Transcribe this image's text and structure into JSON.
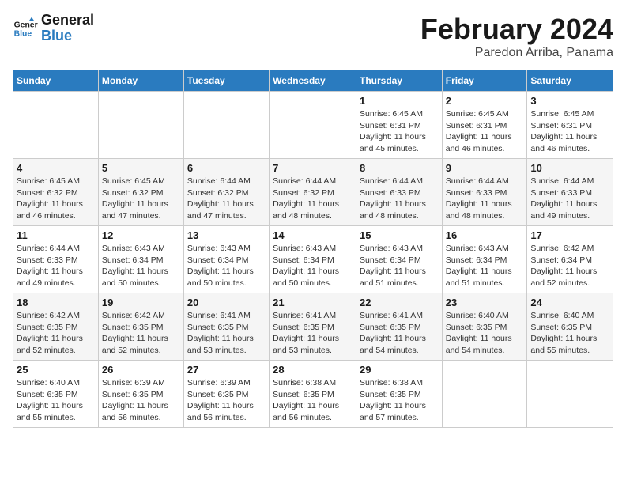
{
  "header": {
    "logo_general": "General",
    "logo_blue": "Blue",
    "title": "February 2024",
    "subtitle": "Paredon Arriba, Panama"
  },
  "calendar": {
    "days_of_week": [
      "Sunday",
      "Monday",
      "Tuesday",
      "Wednesday",
      "Thursday",
      "Friday",
      "Saturday"
    ],
    "weeks": [
      [
        {
          "day": "",
          "details": ""
        },
        {
          "day": "",
          "details": ""
        },
        {
          "day": "",
          "details": ""
        },
        {
          "day": "",
          "details": ""
        },
        {
          "day": "1",
          "details": "Sunrise: 6:45 AM\nSunset: 6:31 PM\nDaylight: 11 hours\nand 45 minutes."
        },
        {
          "day": "2",
          "details": "Sunrise: 6:45 AM\nSunset: 6:31 PM\nDaylight: 11 hours\nand 46 minutes."
        },
        {
          "day": "3",
          "details": "Sunrise: 6:45 AM\nSunset: 6:31 PM\nDaylight: 11 hours\nand 46 minutes."
        }
      ],
      [
        {
          "day": "4",
          "details": "Sunrise: 6:45 AM\nSunset: 6:32 PM\nDaylight: 11 hours\nand 46 minutes."
        },
        {
          "day": "5",
          "details": "Sunrise: 6:45 AM\nSunset: 6:32 PM\nDaylight: 11 hours\nand 47 minutes."
        },
        {
          "day": "6",
          "details": "Sunrise: 6:44 AM\nSunset: 6:32 PM\nDaylight: 11 hours\nand 47 minutes."
        },
        {
          "day": "7",
          "details": "Sunrise: 6:44 AM\nSunset: 6:32 PM\nDaylight: 11 hours\nand 48 minutes."
        },
        {
          "day": "8",
          "details": "Sunrise: 6:44 AM\nSunset: 6:33 PM\nDaylight: 11 hours\nand 48 minutes."
        },
        {
          "day": "9",
          "details": "Sunrise: 6:44 AM\nSunset: 6:33 PM\nDaylight: 11 hours\nand 48 minutes."
        },
        {
          "day": "10",
          "details": "Sunrise: 6:44 AM\nSunset: 6:33 PM\nDaylight: 11 hours\nand 49 minutes."
        }
      ],
      [
        {
          "day": "11",
          "details": "Sunrise: 6:44 AM\nSunset: 6:33 PM\nDaylight: 11 hours\nand 49 minutes."
        },
        {
          "day": "12",
          "details": "Sunrise: 6:43 AM\nSunset: 6:34 PM\nDaylight: 11 hours\nand 50 minutes."
        },
        {
          "day": "13",
          "details": "Sunrise: 6:43 AM\nSunset: 6:34 PM\nDaylight: 11 hours\nand 50 minutes."
        },
        {
          "day": "14",
          "details": "Sunrise: 6:43 AM\nSunset: 6:34 PM\nDaylight: 11 hours\nand 50 minutes."
        },
        {
          "day": "15",
          "details": "Sunrise: 6:43 AM\nSunset: 6:34 PM\nDaylight: 11 hours\nand 51 minutes."
        },
        {
          "day": "16",
          "details": "Sunrise: 6:43 AM\nSunset: 6:34 PM\nDaylight: 11 hours\nand 51 minutes."
        },
        {
          "day": "17",
          "details": "Sunrise: 6:42 AM\nSunset: 6:34 PM\nDaylight: 11 hours\nand 52 minutes."
        }
      ],
      [
        {
          "day": "18",
          "details": "Sunrise: 6:42 AM\nSunset: 6:35 PM\nDaylight: 11 hours\nand 52 minutes."
        },
        {
          "day": "19",
          "details": "Sunrise: 6:42 AM\nSunset: 6:35 PM\nDaylight: 11 hours\nand 52 minutes."
        },
        {
          "day": "20",
          "details": "Sunrise: 6:41 AM\nSunset: 6:35 PM\nDaylight: 11 hours\nand 53 minutes."
        },
        {
          "day": "21",
          "details": "Sunrise: 6:41 AM\nSunset: 6:35 PM\nDaylight: 11 hours\nand 53 minutes."
        },
        {
          "day": "22",
          "details": "Sunrise: 6:41 AM\nSunset: 6:35 PM\nDaylight: 11 hours\nand 54 minutes."
        },
        {
          "day": "23",
          "details": "Sunrise: 6:40 AM\nSunset: 6:35 PM\nDaylight: 11 hours\nand 54 minutes."
        },
        {
          "day": "24",
          "details": "Sunrise: 6:40 AM\nSunset: 6:35 PM\nDaylight: 11 hours\nand 55 minutes."
        }
      ],
      [
        {
          "day": "25",
          "details": "Sunrise: 6:40 AM\nSunset: 6:35 PM\nDaylight: 11 hours\nand 55 minutes."
        },
        {
          "day": "26",
          "details": "Sunrise: 6:39 AM\nSunset: 6:35 PM\nDaylight: 11 hours\nand 56 minutes."
        },
        {
          "day": "27",
          "details": "Sunrise: 6:39 AM\nSunset: 6:35 PM\nDaylight: 11 hours\nand 56 minutes."
        },
        {
          "day": "28",
          "details": "Sunrise: 6:38 AM\nSunset: 6:35 PM\nDaylight: 11 hours\nand 56 minutes."
        },
        {
          "day": "29",
          "details": "Sunrise: 6:38 AM\nSunset: 6:35 PM\nDaylight: 11 hours\nand 57 minutes."
        },
        {
          "day": "",
          "details": ""
        },
        {
          "day": "",
          "details": ""
        }
      ]
    ]
  }
}
